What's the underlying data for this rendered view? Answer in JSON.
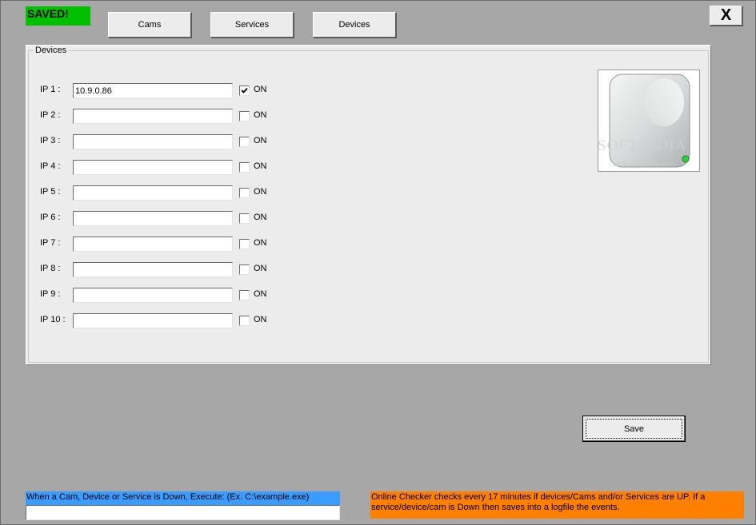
{
  "status": {
    "saved_label": "SAVED!"
  },
  "nav": {
    "cams_label": "Cams",
    "services_label": "Services",
    "devices_label": "Devices"
  },
  "close_label": "X",
  "devices_group": {
    "title": "Devices",
    "on_label": "ON",
    "rows": [
      {
        "label": "IP 1 :",
        "value": "10.9.0.86",
        "checked": true
      },
      {
        "label": "IP 2 :",
        "value": "",
        "checked": false
      },
      {
        "label": "IP 3 :",
        "value": "",
        "checked": false
      },
      {
        "label": "IP 4 :",
        "value": "",
        "checked": false
      },
      {
        "label": "IP 5 :",
        "value": "",
        "checked": false
      },
      {
        "label": "IP 6 :",
        "value": "",
        "checked": false
      },
      {
        "label": "IP 7 :",
        "value": "",
        "checked": false
      },
      {
        "label": "IP 8 :",
        "value": "",
        "checked": false
      },
      {
        "label": "IP 9 :",
        "value": "",
        "checked": false
      },
      {
        "label": "IP 10 :",
        "value": "",
        "checked": false
      }
    ],
    "image_icon": "hard-drive-icon",
    "watermark": "SOFTPEDIA",
    "watermark_url": "www.softpedia.com"
  },
  "save_label": "Save",
  "execute": {
    "label": "When a Cam, Device or Service is Down, Execute: (Ex. C:\\example.exe)",
    "value": ""
  },
  "info_text": "Online Checker checks every 17 minutes if devices/Cams and/or Services are UP. If a service/device/cam is Down then  saves into a logfile  the events.",
  "colors": {
    "saved": "#00c000",
    "execute_label_bg": "#3a9cff",
    "info_bg": "#ff7f00",
    "window_bg": "#a7a7a7",
    "panel_bg": "#ececec"
  }
}
